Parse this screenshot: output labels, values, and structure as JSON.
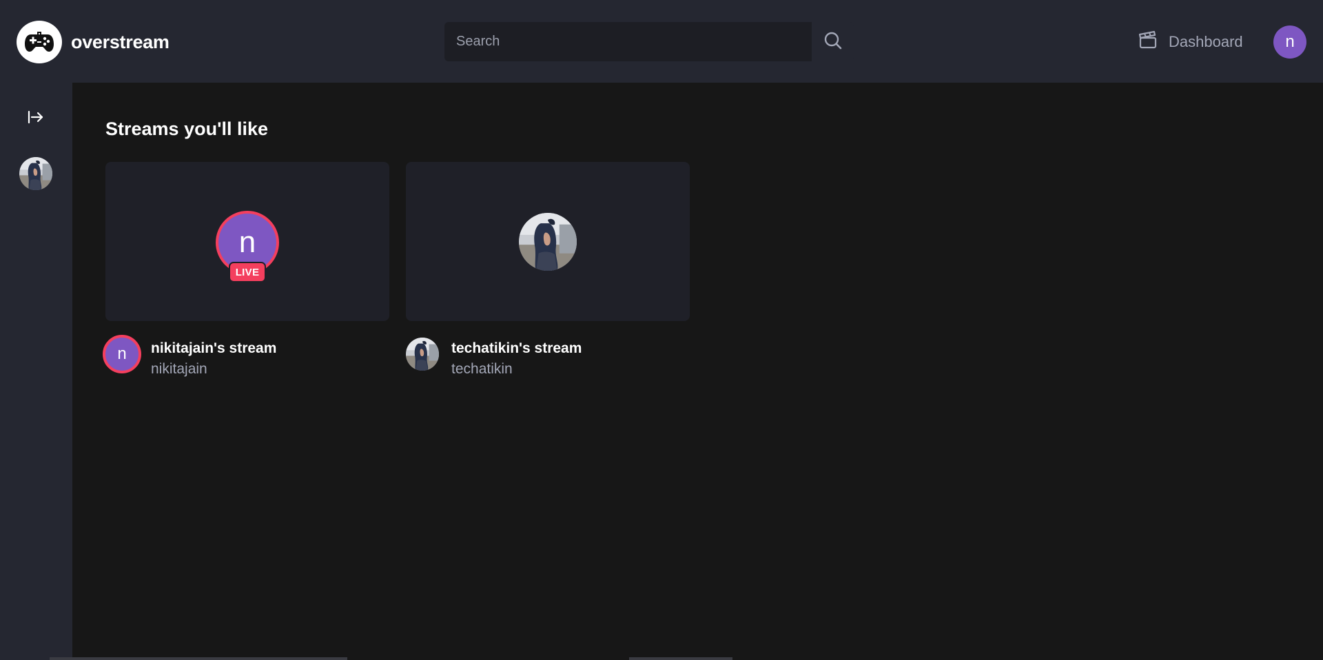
{
  "app": {
    "name": "overstream",
    "logo_icon": "gamepad-icon"
  },
  "search": {
    "placeholder": "Search",
    "value": "",
    "icon": "search-icon"
  },
  "header": {
    "dashboard_label": "Dashboard",
    "dashboard_icon": "clapperboard-icon",
    "user_initial": "n",
    "user_avatar_color": "#7e57c2"
  },
  "sidebar": {
    "toggle_icon": "expand-arrow-icon"
  },
  "main": {
    "section_title": "Streams you'll like",
    "streams": [
      {
        "title": "nikitajain's stream",
        "username": "nikitajain",
        "initial": "n",
        "is_live": true,
        "live_label": "LIVE",
        "avatar_color": "#7e57c2"
      },
      {
        "title": "techatikin's stream",
        "username": "techatikin",
        "is_live": false
      }
    ]
  },
  "colors": {
    "live": "#f43f5e",
    "header_bg": "#252731",
    "page_bg": "#171717",
    "card_bg": "#1f2028",
    "muted_text": "#a3a7b7"
  }
}
